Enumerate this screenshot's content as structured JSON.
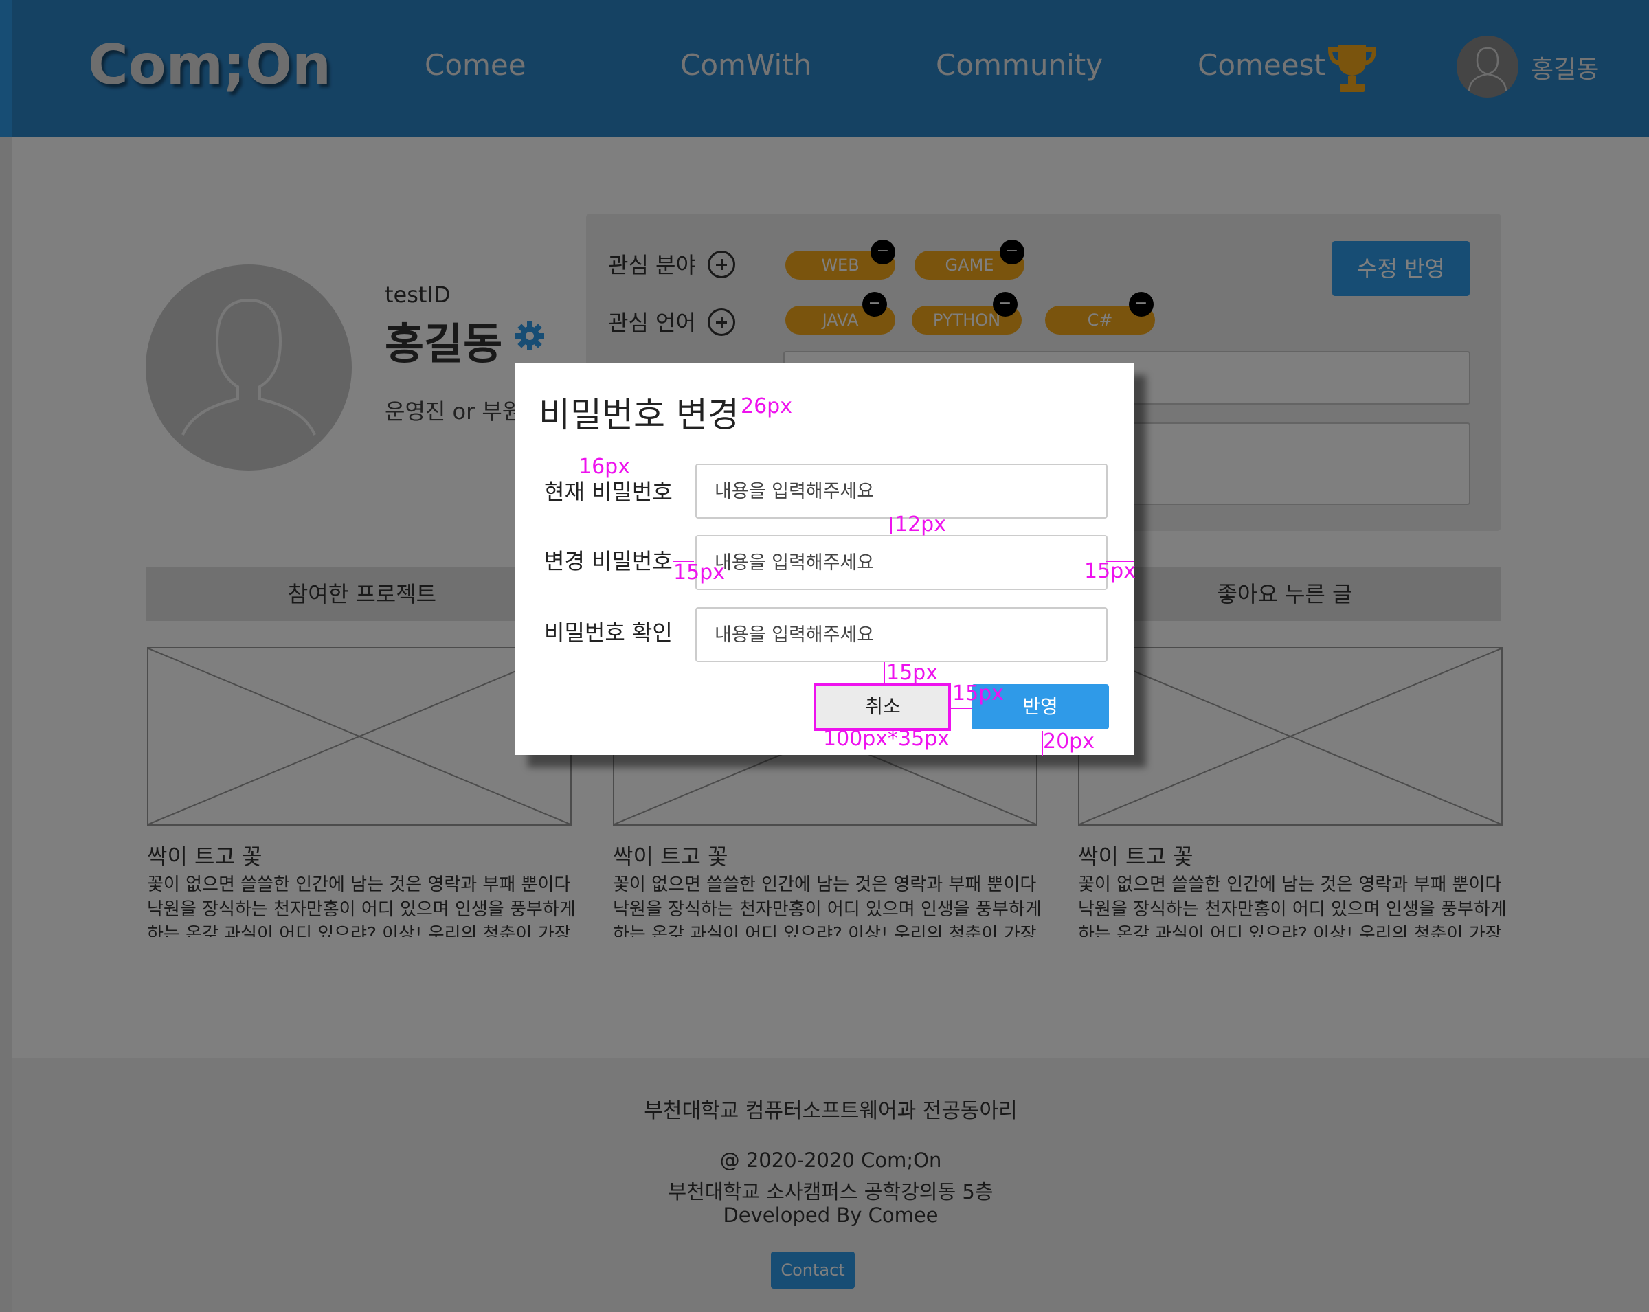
{
  "header": {
    "logo": "Com;On",
    "nav": [
      "Comee",
      "ComWith",
      "Community",
      "Comeest"
    ],
    "user_name": "홍길동"
  },
  "profile": {
    "user_id": "testID",
    "name": "홍길동",
    "role": "운영진 or 부원"
  },
  "interests": {
    "field_label": "관심 분야",
    "language_label": "관심 언어",
    "fields": [
      "WEB",
      "GAME"
    ],
    "languages": [
      "JAVA",
      "PYTHON",
      "C#"
    ],
    "remove_glyph": "−",
    "apply_label": "수정 반영"
  },
  "tabs": {
    "projects": "참여한 프로젝트",
    "liked": "좋아요 누른 글"
  },
  "cards": [
    {
      "title": "싹이 트고 꽃",
      "body": "꽃이 없으면 쓸쓸한 인간에 남는 것은 영락과 부패 뿐이다 낙원을 장식하는 천자만홍이 어디 있으며 인생을 풍부하게 하는 온갖 과실이 어디 있으랴? 이상! 우리의 청춘이 가장"
    },
    {
      "title": "싹이 트고 꽃",
      "body": "꽃이 없으면 쓸쓸한 인간에 남는 것은 영락과 부패 뿐이다 낙원을 장식하는 천자만홍이 어디 있으며 인생을 풍부하게 하는 온갖 과실이 어디 있으랴? 이상! 우리의 청춘이 가장"
    },
    {
      "title": "싹이 트고 꽃",
      "body": "꽃이 없으면 쓸쓸한 인간에 남는 것은 영락과 부패 뿐이다 낙원을 장식하는 천자만홍이 어디 있으며 인생을 풍부하게 하는 온갖 과실이 어디 있으랴? 이상! 우리의 청춘이 가장"
    }
  ],
  "footer": {
    "org": "부천대학교 컴퓨터소프트웨어과 전공동아리",
    "copyright": "@ 2020-2020 Com;On",
    "address": "부천대학교 소사캠퍼스 공학강의동 5층",
    "developer": "Developed By Comee",
    "contact": "Contact"
  },
  "modal": {
    "title": "비밀번호 변경",
    "fields": [
      {
        "label": "현재 비밀번호",
        "placeholder": "내용을 입력해주세요"
      },
      {
        "label": "변경 비밀번호",
        "placeholder": "내용을 입력해주세요"
      },
      {
        "label": "비밀번호 확인",
        "placeholder": "내용을 입력해주세요"
      }
    ],
    "cancel_label": "취소",
    "confirm_label": "반영"
  },
  "annotations": {
    "title_size": "26px",
    "label_size": "16px",
    "field_gap": "12px",
    "label_input_gap": "15px",
    "right_padding": "15px",
    "button_top_gap": "15px",
    "button_gap": "15px",
    "button_size": "100px*35px",
    "bottom_padding": "20px"
  },
  "colors": {
    "header_bg": "#2b84c7",
    "accent": "#2f9ae8",
    "tag": "#f5a81a",
    "annotation": "#ee12ee"
  }
}
